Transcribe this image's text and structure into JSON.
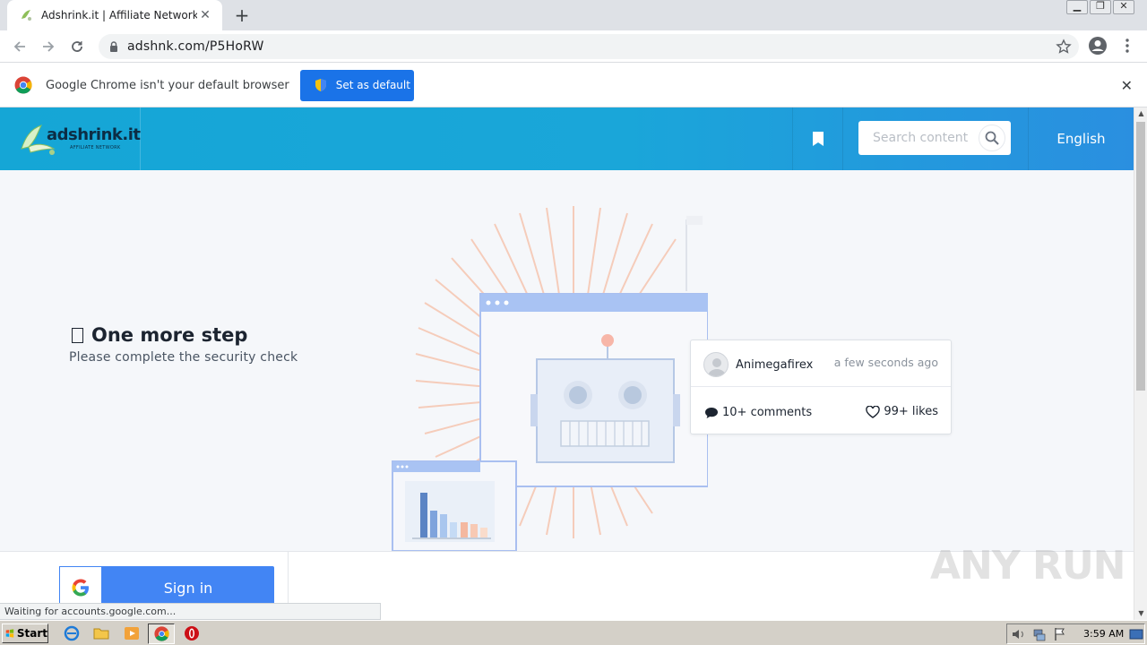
{
  "browser": {
    "tab_title": "Adshrink.it | Affiliate Network",
    "tab_close": "✕",
    "new_tab": "+",
    "url": "adshnk.com/P5HoRW",
    "infobar_text": "Google Chrome isn't your default browser",
    "infobar_button": "Set as default",
    "infobar_close": "✕",
    "status_text": "Waiting for accounts.google.com..."
  },
  "site": {
    "logo_text": "adshrink.it",
    "logo_subtitle": "AFFILIATE NETWORK",
    "search_placeholder": "Search content",
    "language": "English",
    "step_title": "One more step",
    "step_subtitle": "Please complete the security check"
  },
  "post_card": {
    "author": "Animegafirex",
    "time": "a few seconds ago",
    "comments": "10+ comments",
    "likes": "99+ likes"
  },
  "footer": {
    "signin_label": "Sign in"
  },
  "watermark": "ANY RUN",
  "taskbar": {
    "start_label": "Start",
    "clock": "3:59 AM"
  },
  "colors": {
    "header_gradient_start": "#15a6d6",
    "header_gradient_end": "#2a8fe0",
    "chrome_blue": "#1a73e8",
    "google_blue": "#4285f4"
  }
}
